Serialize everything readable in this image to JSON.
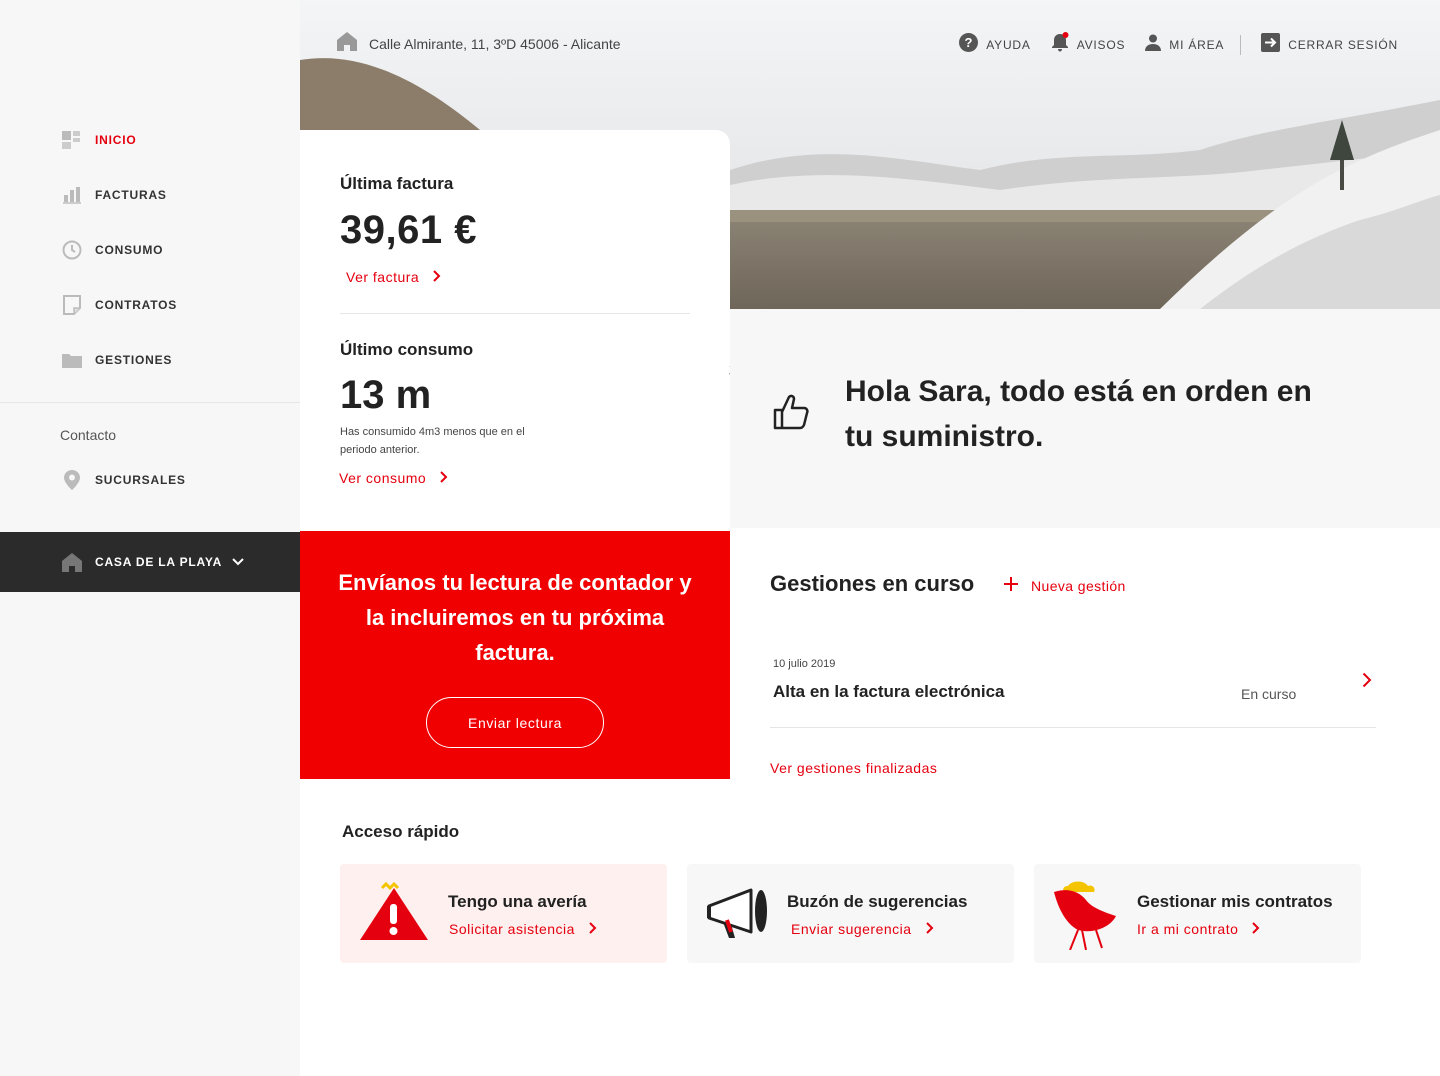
{
  "brand": {
    "accent": "#e5000f",
    "promo_bg": "#f00000",
    "dark": "#2b2b2b"
  },
  "sidebar": {
    "items": [
      {
        "label": "INICIO",
        "icon": "dashboard-icon",
        "active": true
      },
      {
        "label": "FACTURAS",
        "icon": "bar-chart-icon"
      },
      {
        "label": "CONSUMO",
        "icon": "clock-icon"
      },
      {
        "label": "CONTRATOS",
        "icon": "document-icon"
      },
      {
        "label": "GESTIONES",
        "icon": "folder-icon"
      }
    ],
    "contact_title": "Contacto",
    "branches_label": "SUCURSALES",
    "property_label": "CASA DE LA PLAYA"
  },
  "header": {
    "address": "Calle Almirante, 11, 3ºD 45006 - Alicante",
    "help": "AYUDA",
    "notices": "AVISOS",
    "my_area": "MI ÁREA",
    "logout": "CERRAR SESIÓN"
  },
  "bill": {
    "title": "Última factura",
    "amount": "39,61 €",
    "link": "Ver factura"
  },
  "consumption": {
    "title": "Último consumo",
    "value": "13 m",
    "unit_exp": "3",
    "note": "Has consumido 4m3 menos que en el periodo anterior.",
    "link": "Ver consumo"
  },
  "greeting": {
    "text": "Hola Sara, todo está en orden en tu suministro."
  },
  "promo": {
    "text": "Envíanos tu lectura de contador y la incluiremos en tu próxima factura.",
    "button": "Enviar lectura"
  },
  "procedures": {
    "title": "Gestiones en curso",
    "new_label": "Nueva gestión",
    "items": [
      {
        "date": "10 julio 2019",
        "name": "Alta en la factura electrónica",
        "status": "En curso"
      }
    ],
    "finished_link": "Ver gestiones finalizadas"
  },
  "quick_access": {
    "title": "Acceso rápido",
    "cards": [
      {
        "title": "Tengo una avería",
        "link": "Solicitar asistencia"
      },
      {
        "title": "Buzón de sugerencias",
        "link": "Enviar sugerencia"
      },
      {
        "title": "Gestionar mis contratos",
        "link": "Ir a mi contrato"
      }
    ]
  }
}
